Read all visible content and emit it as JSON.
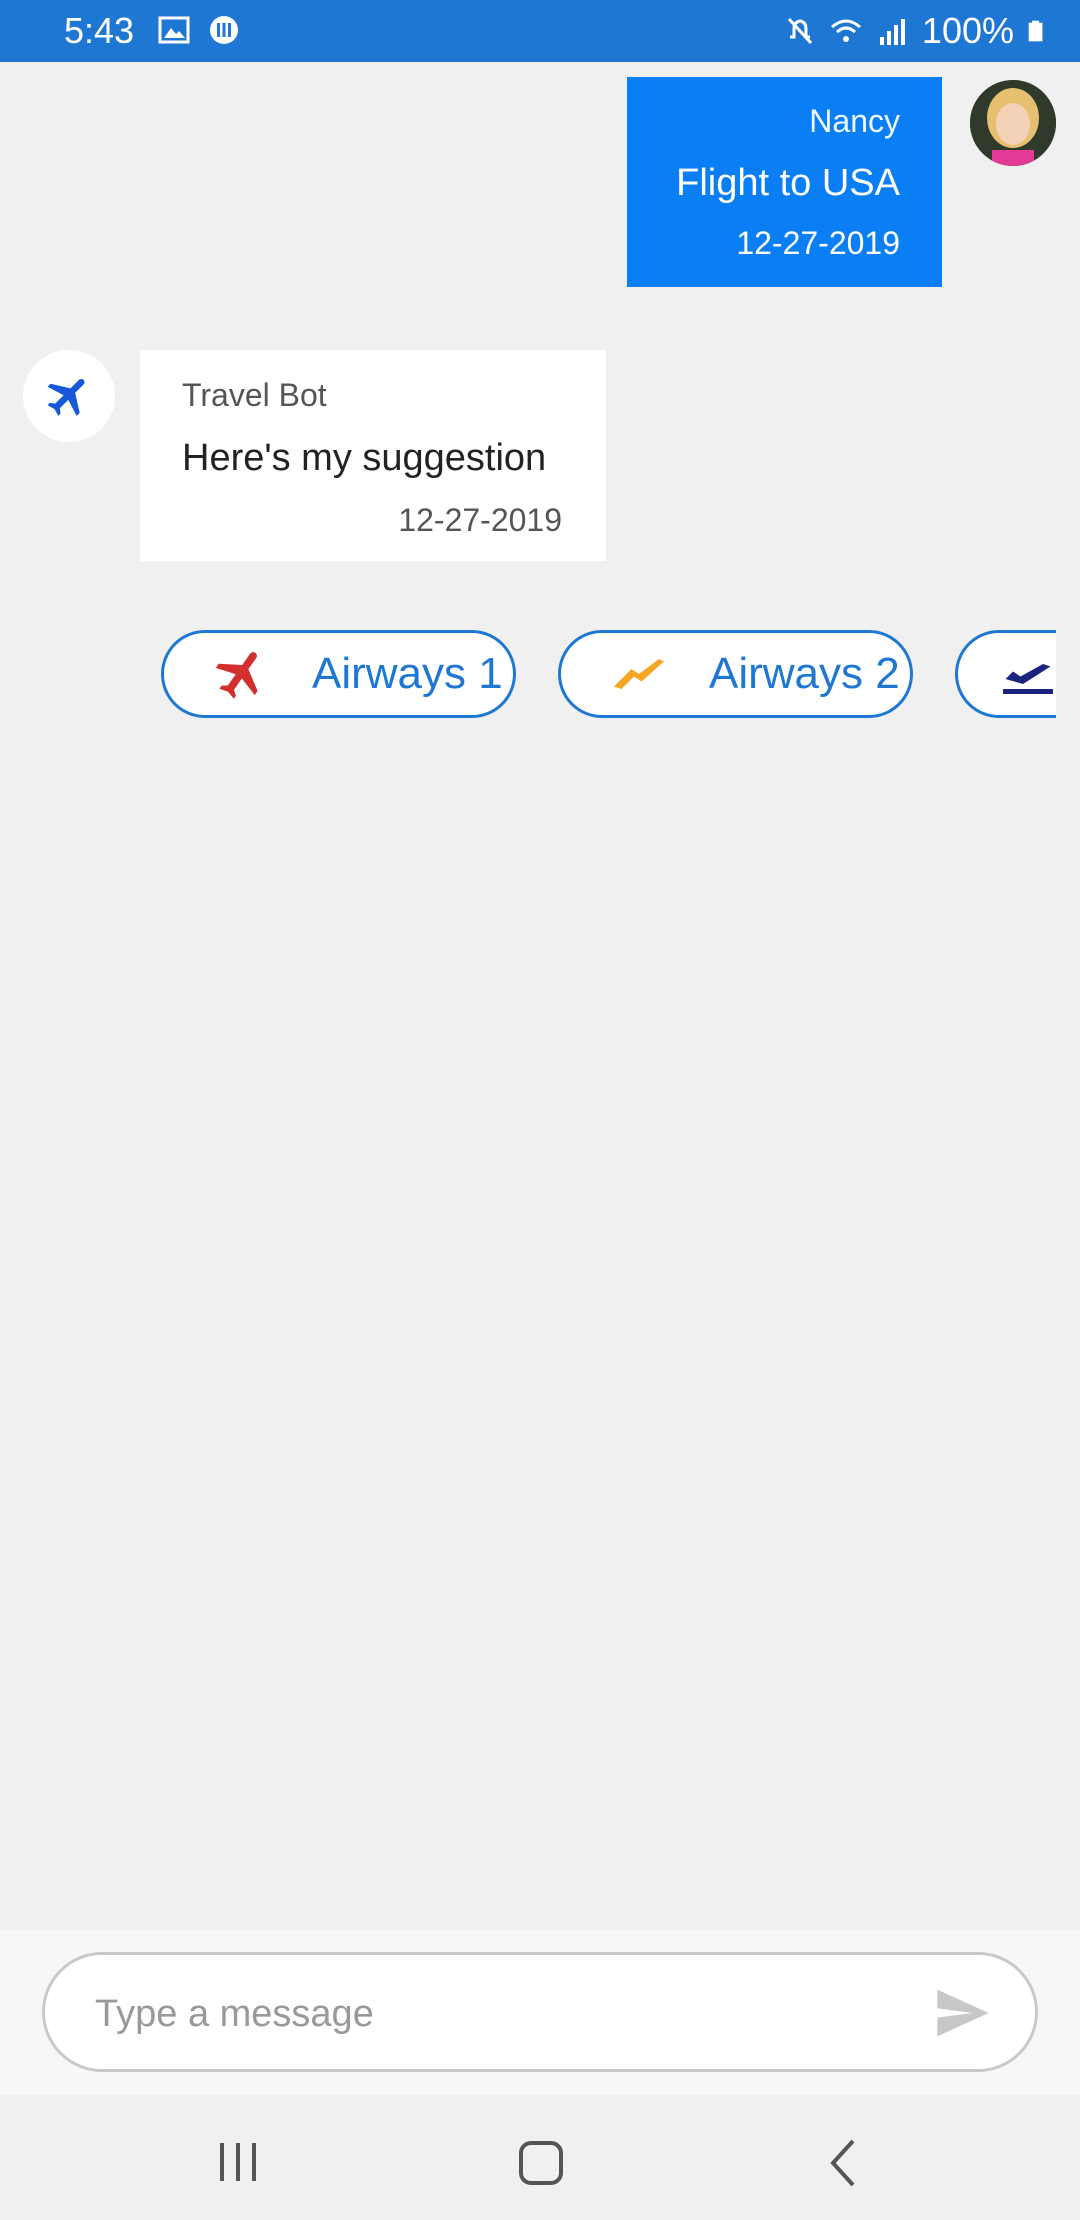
{
  "status_bar": {
    "time": "5:43",
    "battery": "100%",
    "icons": [
      "gallery-icon",
      "app-notification-icon",
      "mute-icon",
      "wifi-icon",
      "signal-icon",
      "battery-icon"
    ]
  },
  "chat": {
    "outgoing": {
      "author": "Nancy",
      "text": "Flight to USA",
      "date": "12-27-2019",
      "color": "#0a7ff5"
    },
    "incoming": {
      "author": "Travel Bot",
      "text": "Here's my suggestion",
      "date": "12-27-2019"
    },
    "suggestions": [
      {
        "label": "Airways 1",
        "icon": "red-plane-icon",
        "color": "#d32f2f"
      },
      {
        "label": "Airways 2",
        "icon": "orange-plane-icon",
        "color": "#f5a623"
      },
      {
        "label": "",
        "icon": "navy-plane-icon",
        "color": "#1a237e"
      }
    ]
  },
  "composer": {
    "placeholder": "Type a message"
  },
  "nav": [
    "recent-apps-icon",
    "home-icon",
    "back-icon"
  ]
}
